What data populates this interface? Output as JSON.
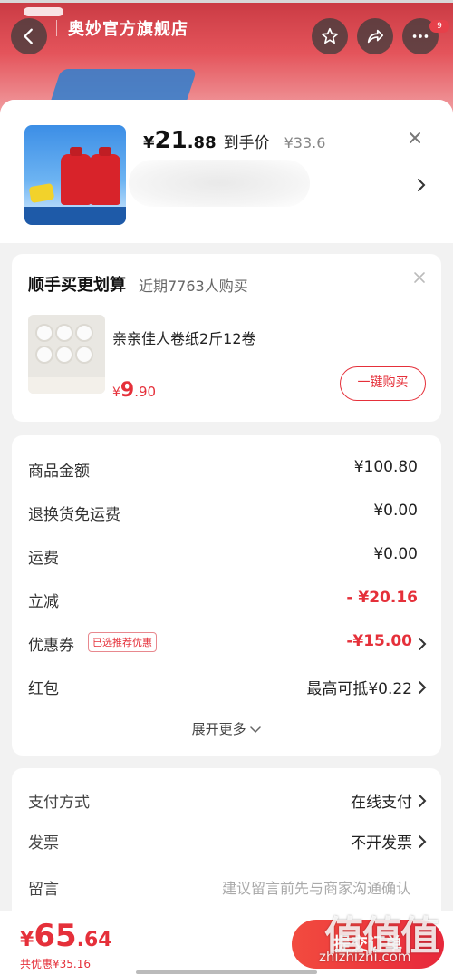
{
  "header": {
    "store_name": "奥妙官方旗舰店",
    "icons": [
      "back-icon",
      "star-icon",
      "share-icon",
      "more-icon"
    ],
    "notification_count": "9"
  },
  "product": {
    "yen": "¥",
    "price_int": "21",
    "price_dec": ".88",
    "price_label": "到手价",
    "original_price": "¥33.6"
  },
  "recommend": {
    "title": "顺手买更划算",
    "subtitle": "近期7763人购买",
    "item_name": "亲亲佳人卷纸2斤12卷",
    "yen": "¥",
    "price_int": "9",
    "price_dec": ".90",
    "buy_label": "一键购买"
  },
  "summary": {
    "goods_label": "商品金额",
    "goods_value": "¥100.80",
    "return_label": "退换货免运费",
    "return_value": "¥0.00",
    "shipping_label": "运费",
    "shipping_value": "¥0.00",
    "discount_label": "立减",
    "discount_value": "- ¥20.16",
    "coupon_label": "优惠券",
    "coupon_badge": "已选推荐优惠",
    "coupon_value": "-¥15.00",
    "redpacket_label": "红包",
    "redpacket_value": "最高可抵¥0.22",
    "expand_label": "展开更多"
  },
  "payment": {
    "method_label": "支付方式",
    "method_value": "在线支付",
    "invoice_label": "发票",
    "invoice_value": "不开发票",
    "message_label": "留言",
    "message_placeholder": "建议留言前先与商家沟通确认"
  },
  "bottom": {
    "yen": "¥",
    "total_int": "65",
    "total_dec": ".64",
    "saved": "共优惠¥35.16",
    "submit_label": "提交订单"
  },
  "watermark": {
    "big": "值值值",
    "small": "zhizhizhi.com"
  },
  "colors": {
    "accent": "#e5303a",
    "banner": "#c93a43"
  }
}
